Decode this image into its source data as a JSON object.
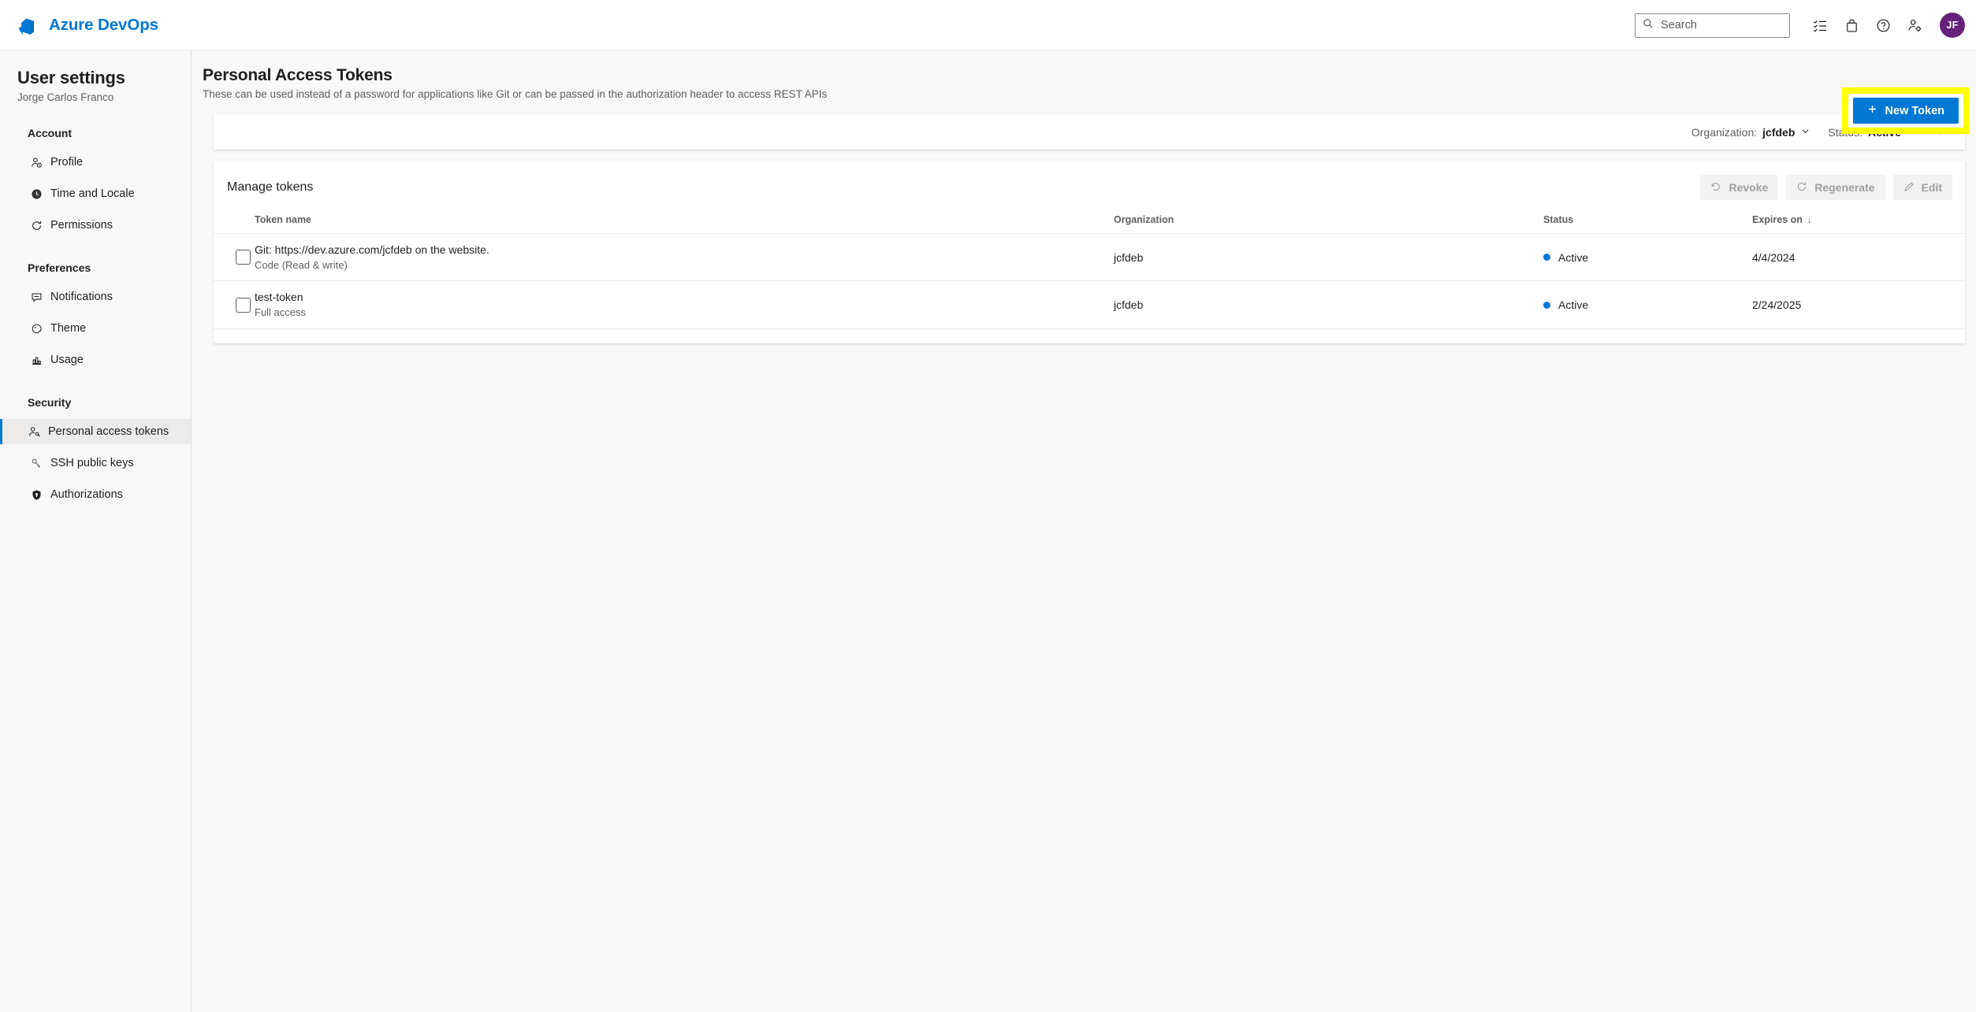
{
  "topbar": {
    "brand": "Azure DevOps",
    "search_placeholder": "Search",
    "icons": [
      "checklist-icon",
      "marketplace-bag-icon",
      "help-icon",
      "user-settings-gear-icon"
    ],
    "avatar_initials": "JF",
    "avatar_color": "#68217a"
  },
  "sidebar": {
    "title": "User settings",
    "user": "Jorge Carlos Franco",
    "groups": [
      {
        "heading": "Account",
        "items": [
          {
            "label": "Profile",
            "icon": "person-icon",
            "selected": false
          },
          {
            "label": "Time and Locale",
            "icon": "clock-icon",
            "selected": false
          },
          {
            "label": "Permissions",
            "icon": "refresh-icon",
            "selected": false
          }
        ]
      },
      {
        "heading": "Preferences",
        "items": [
          {
            "label": "Notifications",
            "icon": "comment-icon",
            "selected": false
          },
          {
            "label": "Theme",
            "icon": "palette-icon",
            "selected": false
          },
          {
            "label": "Usage",
            "icon": "bar-chart-icon",
            "selected": false
          }
        ]
      },
      {
        "heading": "Security",
        "items": [
          {
            "label": "Personal access tokens",
            "icon": "key-person-icon",
            "selected": true
          },
          {
            "label": "SSH public keys",
            "icon": "ssh-key-icon",
            "selected": false
          },
          {
            "label": "Authorizations",
            "icon": "shield-lock-icon",
            "selected": false
          }
        ]
      }
    ]
  },
  "page": {
    "title": "Personal Access Tokens",
    "description": "These can be used instead of a password for applications like Git or can be passed in the authorization header to access REST APIs",
    "new_token_label": "New Token",
    "new_token_icon": "plus-icon",
    "new_token_color": "#0078d4",
    "highlight_color": "#ffff00"
  },
  "filters": {
    "organization_label": "Organization:",
    "organization_value": "jcfdeb",
    "status_label": "Status:",
    "status_value": "Active",
    "close_icon": "close-icon"
  },
  "tokens_panel": {
    "title": "Manage tokens",
    "actions": [
      {
        "label": "Revoke",
        "icon": "undo-icon",
        "disabled": true
      },
      {
        "label": "Regenerate",
        "icon": "refresh-icon",
        "disabled": true
      },
      {
        "label": "Edit",
        "icon": "pencil-icon",
        "disabled": true
      }
    ],
    "columns": [
      {
        "label": "Token name"
      },
      {
        "label": "Organization"
      },
      {
        "label": "Status"
      },
      {
        "label": "Expires on",
        "sort": "↓"
      }
    ],
    "rows": [
      {
        "checked": false,
        "name": "Git: https://dev.azure.com/jcfdeb on the website.",
        "scope": "Code (Read & write)",
        "organization": "jcfdeb",
        "status": "Active",
        "status_color": "#0078d4",
        "expires_on": "4/4/2024"
      },
      {
        "checked": false,
        "name": "test-token",
        "scope": "Full access",
        "organization": "jcfdeb",
        "status": "Active",
        "status_color": "#0078d4",
        "expires_on": "2/24/2025"
      }
    ]
  }
}
